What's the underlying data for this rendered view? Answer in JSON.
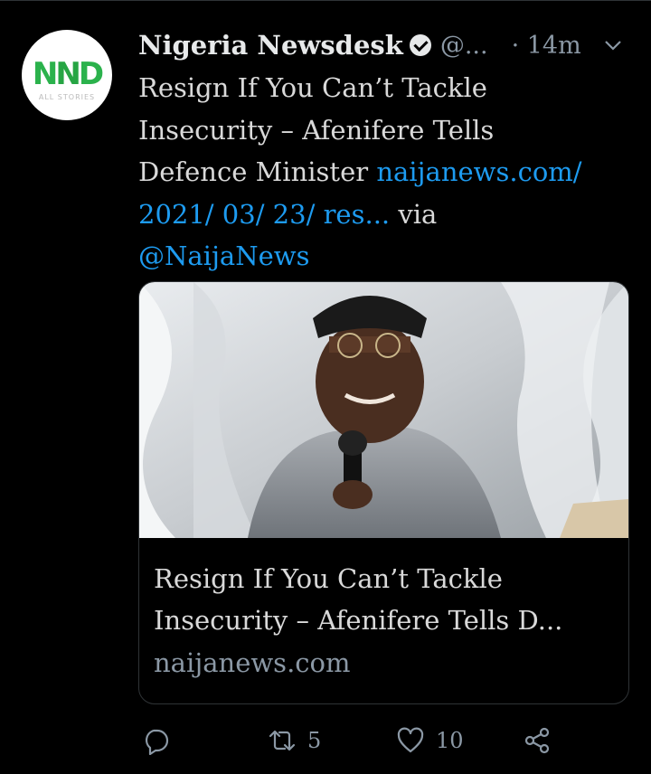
{
  "tweet": {
    "display_name": "Nigeria Newsdesk",
    "handle": "@...",
    "time": "· 14m",
    "text_lines": [
      "Resign If You Can’t Tackle",
      "Insecurity – Afenifere Tells",
      "Defence Minister "
    ],
    "link_part1": "naijanews.com/",
    "link_part2": "2021/ 03/ 23/ res...",
    "via": " via",
    "mention": "@NaijaNews"
  },
  "avatar": {
    "logo_text": "NND",
    "logo_sub": "ALL STORIES"
  },
  "card": {
    "title_line1": "Resign If You Can’t Tackle",
    "title_line2": "Insecurity – Afenifere Tells D...",
    "domain": "naijanews.com"
  },
  "actions": {
    "retweets": "5",
    "likes": "10"
  },
  "colors": {
    "background": "#000000",
    "link": "#1d9bf0",
    "muted": "#8b98a5",
    "border": "#2f3336"
  },
  "icons": [
    "verified-badge-icon",
    "chevron-down-icon",
    "reply-icon",
    "retweet-icon",
    "like-icon",
    "share-icon"
  ]
}
